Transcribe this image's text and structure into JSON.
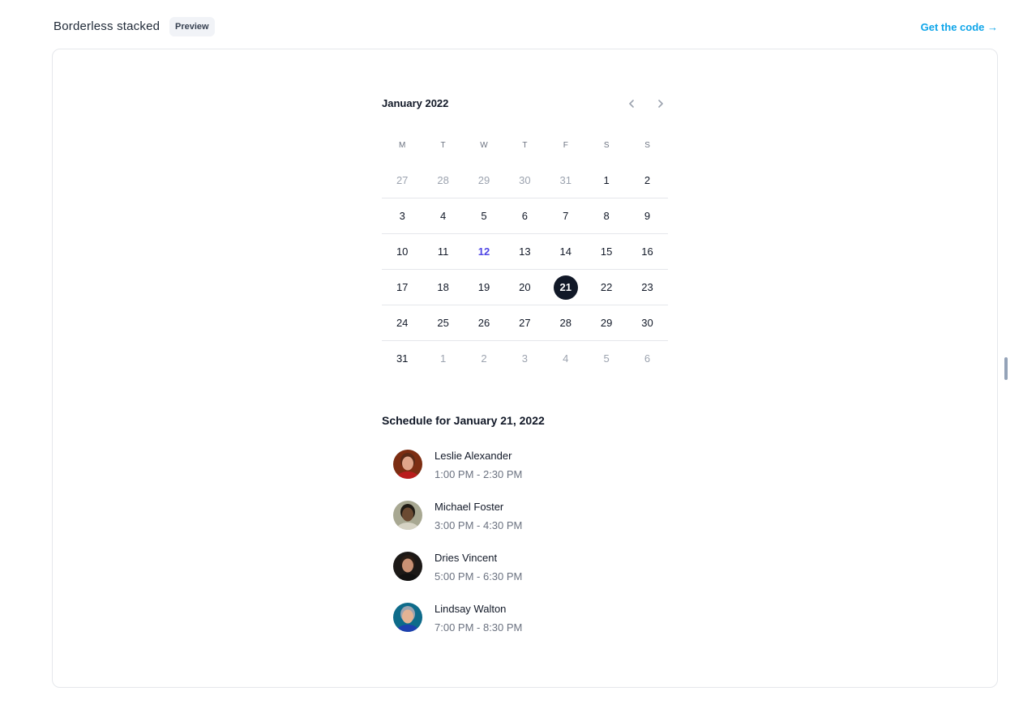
{
  "header": {
    "title": "Borderless stacked",
    "badge": "Preview",
    "code_link": "Get the code →"
  },
  "calendar": {
    "month_label": "January 2022",
    "prev_icon": "chevron-left-icon",
    "next_icon": "chevron-right-icon",
    "weekdays": [
      "M",
      "T",
      "W",
      "T",
      "F",
      "S",
      "S"
    ],
    "weeks": [
      [
        {
          "d": "27",
          "m": true
        },
        {
          "d": "28",
          "m": true
        },
        {
          "d": "29",
          "m": true
        },
        {
          "d": "30",
          "m": true
        },
        {
          "d": "31",
          "m": true
        },
        {
          "d": "1"
        },
        {
          "d": "2"
        }
      ],
      [
        {
          "d": "3"
        },
        {
          "d": "4"
        },
        {
          "d": "5"
        },
        {
          "d": "6"
        },
        {
          "d": "7"
        },
        {
          "d": "8"
        },
        {
          "d": "9"
        }
      ],
      [
        {
          "d": "10"
        },
        {
          "d": "11"
        },
        {
          "d": "12",
          "today": true
        },
        {
          "d": "13"
        },
        {
          "d": "14"
        },
        {
          "d": "15"
        },
        {
          "d": "16"
        }
      ],
      [
        {
          "d": "17"
        },
        {
          "d": "18"
        },
        {
          "d": "19"
        },
        {
          "d": "20"
        },
        {
          "d": "21",
          "selected": true
        },
        {
          "d": "22"
        },
        {
          "d": "23"
        }
      ],
      [
        {
          "d": "24"
        },
        {
          "d": "25"
        },
        {
          "d": "26"
        },
        {
          "d": "27"
        },
        {
          "d": "28"
        },
        {
          "d": "29"
        },
        {
          "d": "30"
        }
      ],
      [
        {
          "d": "31"
        },
        {
          "d": "1",
          "m": true
        },
        {
          "d": "2",
          "m": true
        },
        {
          "d": "3",
          "m": true
        },
        {
          "d": "4",
          "m": true
        },
        {
          "d": "5",
          "m": true
        },
        {
          "d": "6",
          "m": true
        }
      ]
    ]
  },
  "schedule": {
    "title": "Schedule for January 21, 2022",
    "items": [
      {
        "name": "Leslie Alexander",
        "time": "1:00 PM - 2:30 PM",
        "bg": "#7c2d12",
        "skin": "#e0a58a",
        "hair": "#5b2a17",
        "shirt": "#b91c1c"
      },
      {
        "name": "Michael Foster",
        "time": "3:00 PM - 4:30 PM",
        "bg": "#a8a892",
        "skin": "#6b4a32",
        "hair": "#1f1a14",
        "shirt": "#d6d3c4"
      },
      {
        "name": "Dries Vincent",
        "time": "5:00 PM - 6:30 PM",
        "bg": "#1c1917",
        "skin": "#c99174",
        "hair": "#2a1d15",
        "shirt": "#111111"
      },
      {
        "name": "Lindsay Walton",
        "time": "7:00 PM - 8:30 PM",
        "bg": "#0e6b8a",
        "skin": "#e3b394",
        "hair": "#9ca3af",
        "shirt": "#1e40af"
      }
    ]
  },
  "colors": {
    "accent": "#0ea5e9",
    "today": "#4f46e5",
    "selected_bg": "#111827"
  }
}
